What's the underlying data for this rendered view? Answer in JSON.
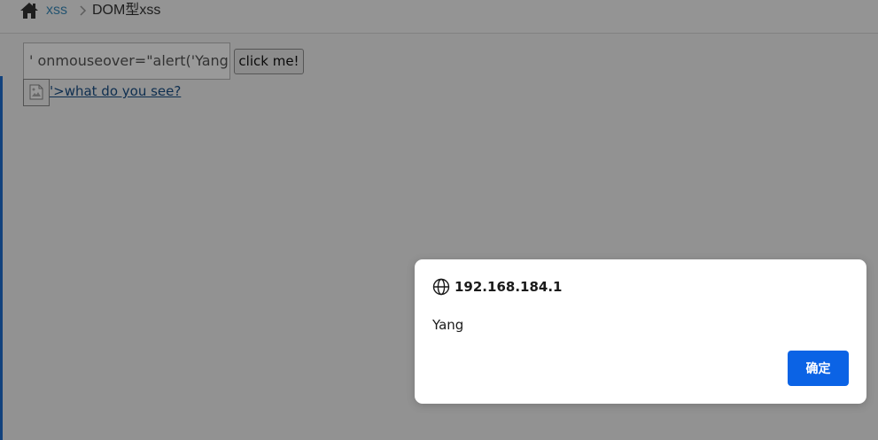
{
  "breadcrumb": {
    "home_icon": "home-icon",
    "link_label": "xss",
    "separator_icon": "chevron-right-icon",
    "current_label": "DOM型xss"
  },
  "form": {
    "input_value": "' onmouseover=\"alert('Yang",
    "button_label": "click me!",
    "broken_image_icon": "broken-image-icon",
    "link_text": "'>what do you see?"
  },
  "dialog": {
    "globe_icon": "globe-icon",
    "origin": "192.168.184.1",
    "message": "Yang",
    "ok_label": "确定"
  },
  "colors": {
    "link": "#3c8dbc",
    "accent": "#1f6fd1",
    "ok_button": "#0b63e5",
    "overlay": "rgba(0,0,0,0.40)"
  }
}
